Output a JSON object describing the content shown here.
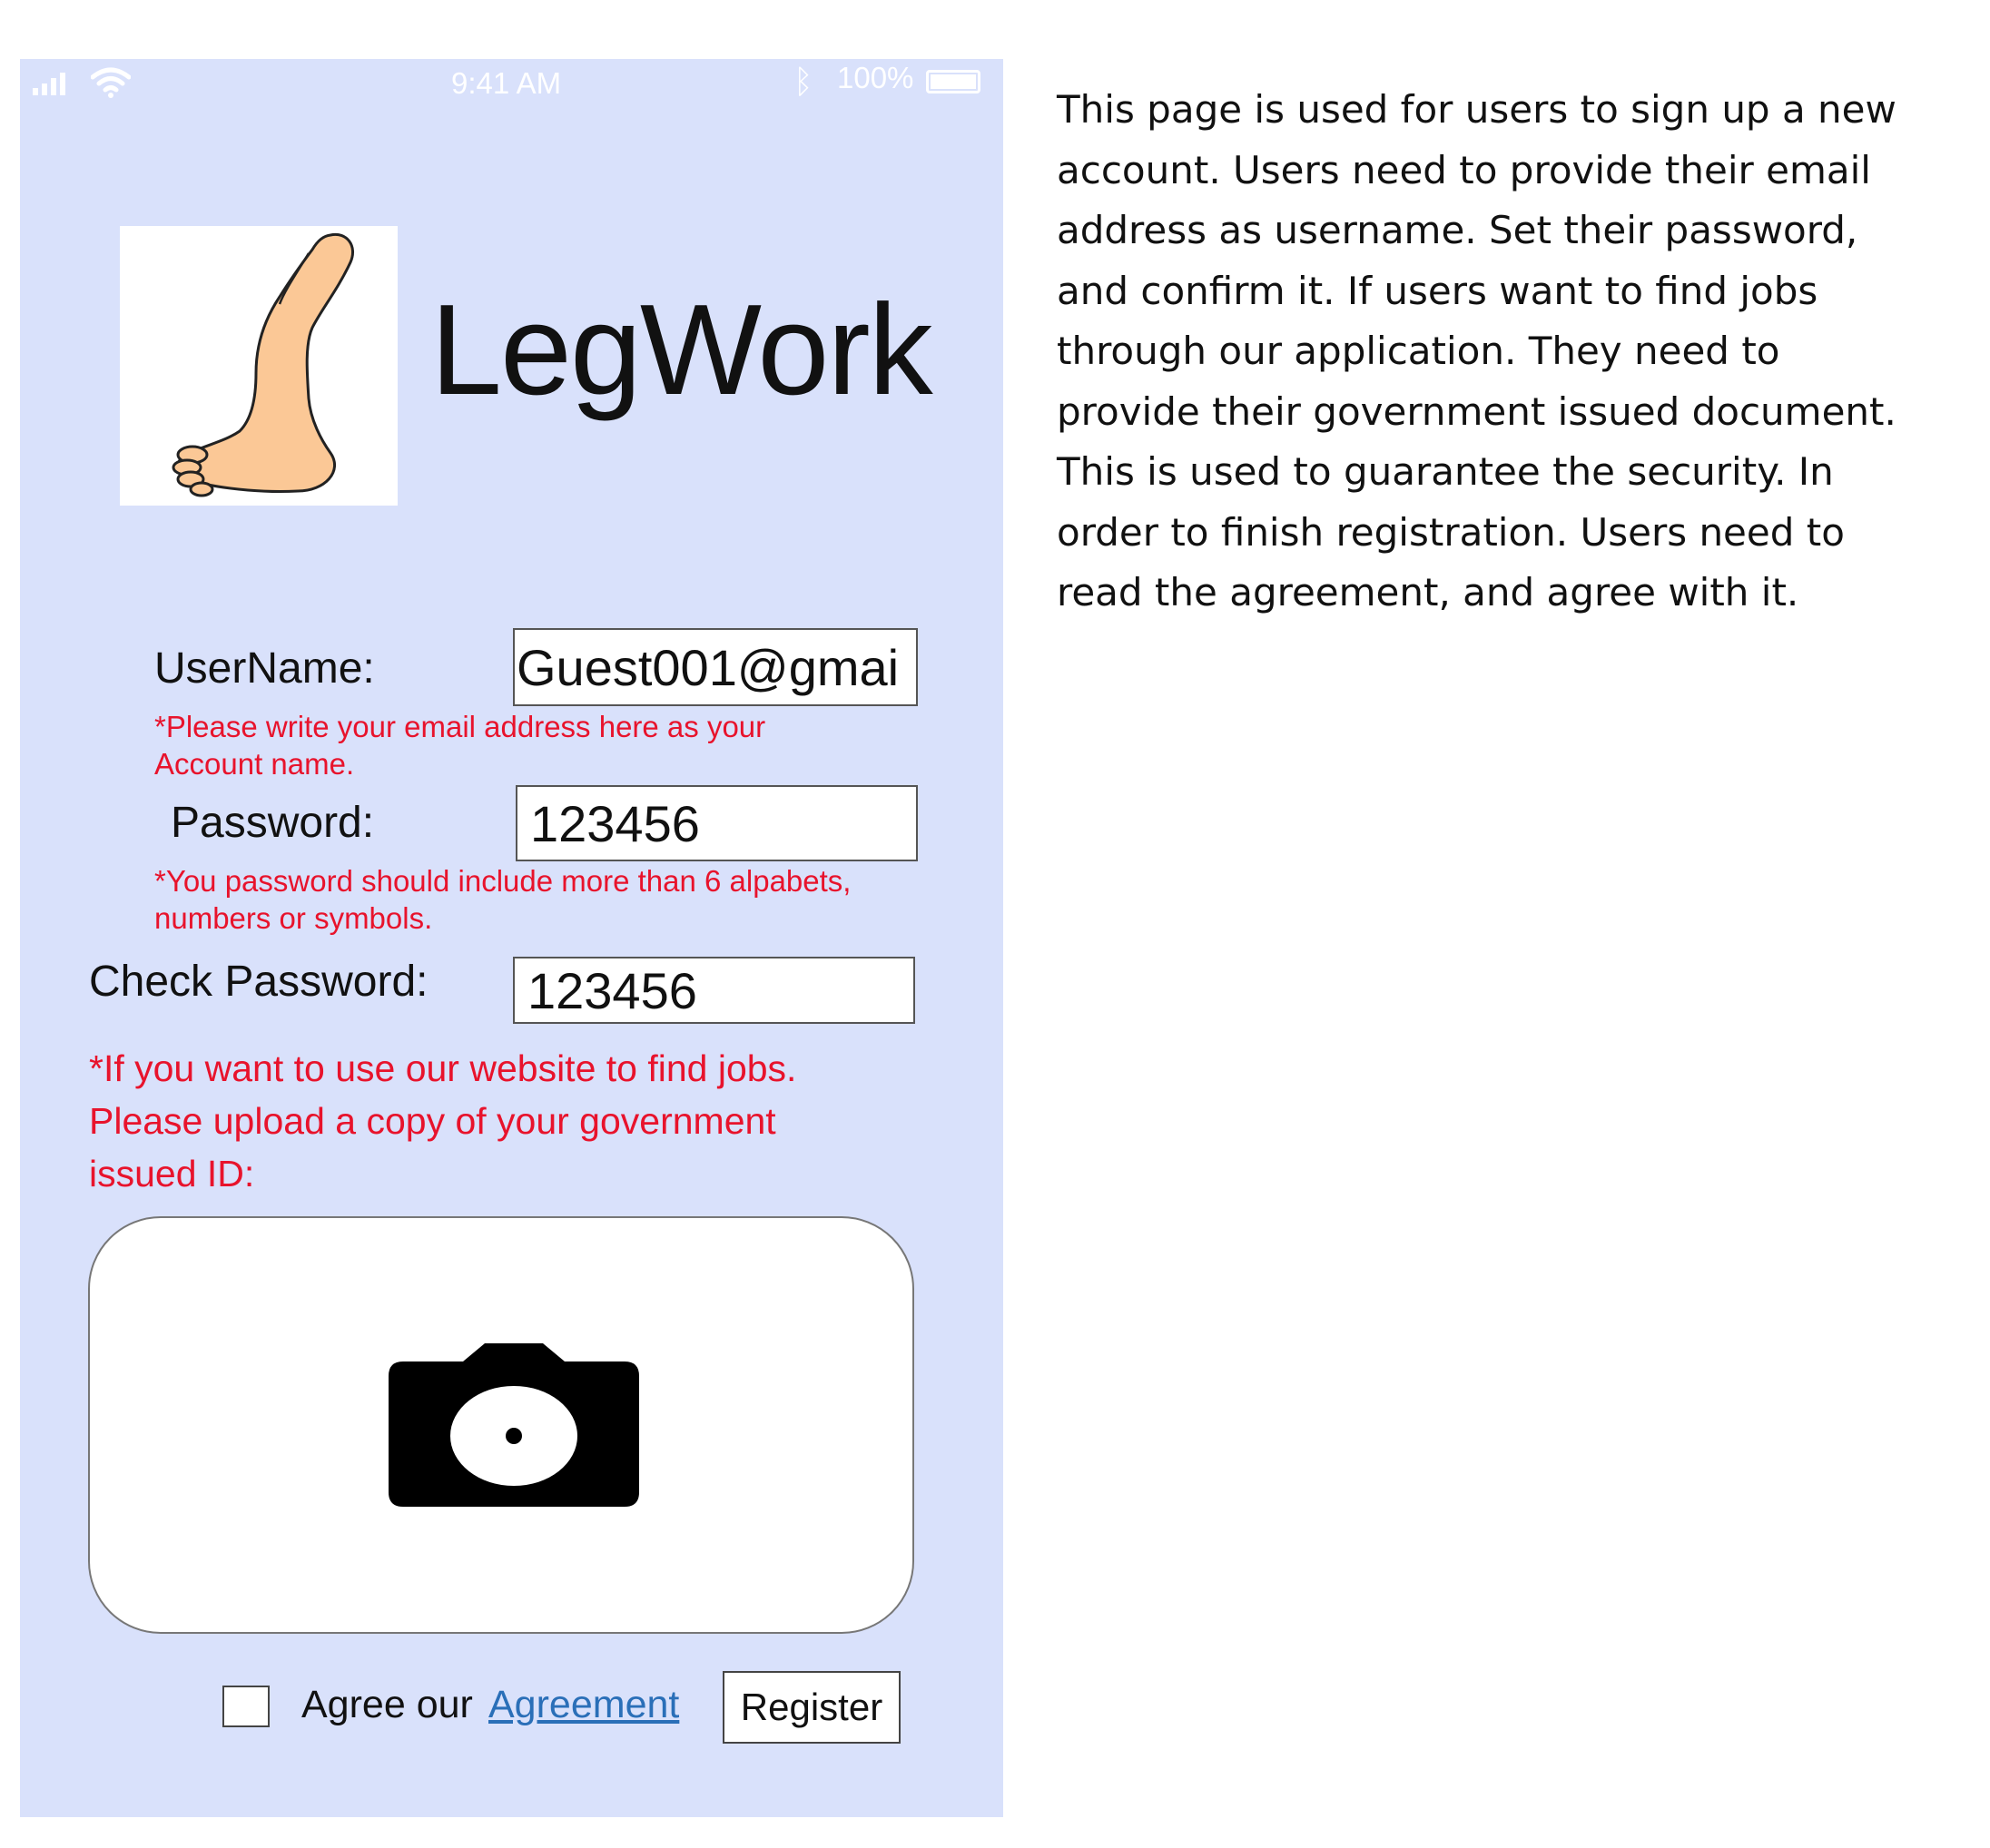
{
  "status_bar": {
    "time": "9:41 AM",
    "battery_pct": "100%",
    "bluetooth_icon": "bluetooth-icon",
    "wifi_icon": "wifi-icon",
    "signal_icon": "signal-icon",
    "battery_icon": "battery-icon"
  },
  "app": {
    "title": "LegWork",
    "logo_icon": "foot-leg-logo"
  },
  "form": {
    "username_label": "UserName:",
    "username_value": "Guest001@gmai",
    "username_hint": "*Please write your email address here as your Account name.",
    "password_label": "Password:",
    "password_value": "123456",
    "password_hint": "*You password should include more than 6 alpabets, numbers or symbols.",
    "check_password_label": "Check Password:",
    "check_password_value": "123456",
    "id_hint": "*If you want to use our website to find jobs. Please upload a copy of your government issued ID:",
    "upload_icon": "camera-icon",
    "agree_text": "Agree our",
    "agreement_link": "Agreement",
    "register_label": "Register",
    "agree_checked": false
  },
  "description": "This page is used for users to sign up a new account. Users need to provide their email address as username. Set their password, and confirm it. If users want to find jobs through our application. They need to provide their government issued document. This is used to guarantee the security. In order to finish registration. Users need to read the agreement, and agree with it.",
  "colors": {
    "phone_background": "#d9e1fb",
    "hint_red": "#e8132c",
    "link_blue": "#2a6fb8",
    "skin": "#fbc896"
  }
}
